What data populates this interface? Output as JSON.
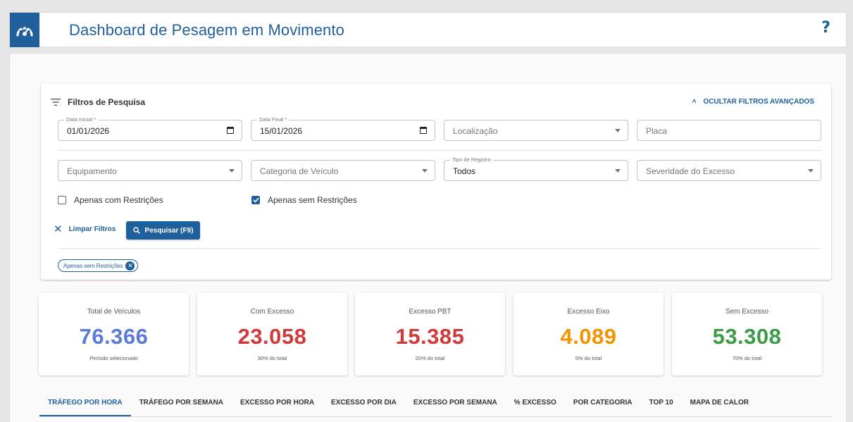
{
  "app": {
    "title": "Dashboard de Pesagem em Movimento",
    "help_label": "?"
  },
  "colors": {
    "brand": "#1f5f9b",
    "total": "#5b7bd5",
    "excess": "#d13a3a",
    "axle": "#f29300",
    "ok": "#3d9a47"
  },
  "filters": {
    "heading": "Filtros de Pesquisa",
    "toggle_label": "OCULTAR FILTROS AVANÇADOS",
    "data_inicial": {
      "label": "Data Inicial *",
      "value": "01/01/2026"
    },
    "data_final": {
      "label": "Data Final *",
      "value": "15/01/2026"
    },
    "localizacao": {
      "placeholder": "Localização"
    },
    "placa": {
      "placeholder": "Placa"
    },
    "equipamento": {
      "placeholder": "Equipamento"
    },
    "categoria": {
      "placeholder": "Categoria de Veículo"
    },
    "tipo_registro": {
      "label": "Tipo de Registro",
      "value": "Todos"
    },
    "severidade": {
      "placeholder": "Severidade do Excesso"
    },
    "check_com": {
      "label": "Apenas com Restrições",
      "checked": false
    },
    "check_sem": {
      "label": "Apenas sem Restrições",
      "checked": true
    },
    "clear_label": "Limpar Filtros",
    "search_label": "Pesquisar (F9)",
    "active_chip": "Apenas sem Restrições"
  },
  "stats": [
    {
      "title": "Total de Veículos",
      "value": "76.366",
      "sub": "Período selecionado",
      "color": "#5b7bd5"
    },
    {
      "title": "Com Excesso",
      "value": "23.058",
      "sub": "30% do total",
      "color": "#d13a3a"
    },
    {
      "title": "Excesso PBT",
      "value": "15.385",
      "sub": "20% do total",
      "color": "#d13a3a"
    },
    {
      "title": "Excesso Eixo",
      "value": "4.089",
      "sub": "5% do total",
      "color": "#f29300"
    },
    {
      "title": "Sem Excesso",
      "value": "53.308",
      "sub": "70% do total",
      "color": "#3d9a47"
    }
  ],
  "tabs": [
    {
      "label": "TRÁFEGO POR HORA",
      "active": true
    },
    {
      "label": "TRÁFEGO POR SEMANA",
      "active": false
    },
    {
      "label": "EXCESSO POR HORA",
      "active": false
    },
    {
      "label": "EXCESSO POR DIA",
      "active": false
    },
    {
      "label": "EXCESSO POR SEMANA",
      "active": false
    },
    {
      "label": "% EXCESSO",
      "active": false
    },
    {
      "label": "POR CATEGORIA",
      "active": false
    },
    {
      "label": "TOP 10",
      "active": false
    },
    {
      "label": "MAPA DE CALOR",
      "active": false
    }
  ]
}
